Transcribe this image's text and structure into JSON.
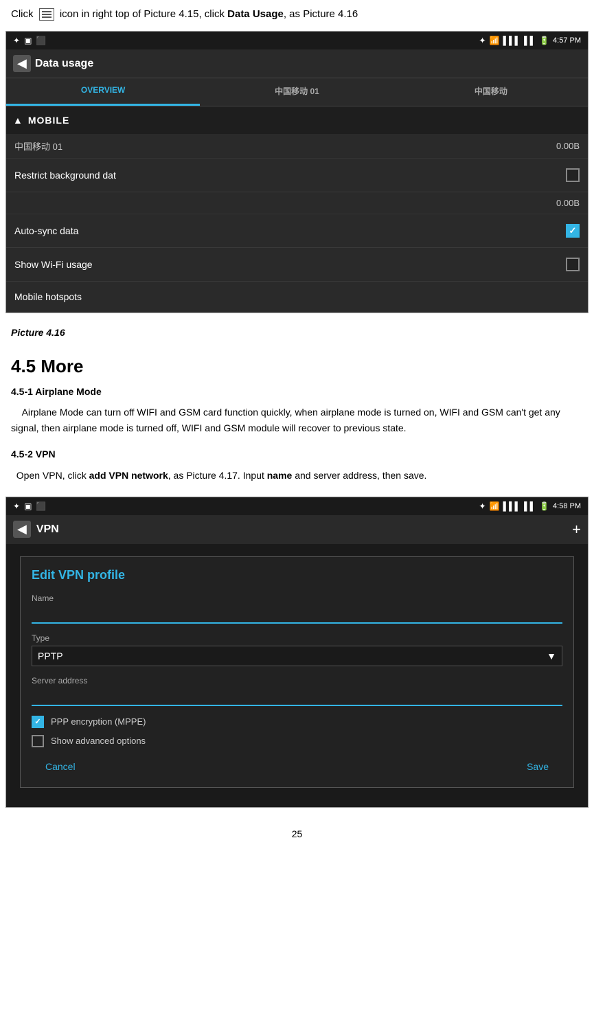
{
  "intro": {
    "text_before": "Click",
    "icon_label": "menu-icon",
    "text_after": " icon in right top of Picture 4.15, click ",
    "bold_text": "Data Usage",
    "text_end": ", as Picture 4.16"
  },
  "data_usage_screen": {
    "status_bar": {
      "time": "4:57 PM",
      "icons": [
        "bluetooth",
        "wifi",
        "signal1",
        "signal2",
        "battery"
      ]
    },
    "title": "Data usage",
    "tabs": [
      {
        "label": "OVERVIEW",
        "active": true
      },
      {
        "label": "中国移动 01",
        "active": false
      },
      {
        "label": "中国移动",
        "active": false
      }
    ],
    "mobile_section": {
      "header": "MOBILE",
      "chevron": "▲",
      "data_row_label": "中国移动 01",
      "data_row_value": "0.00B",
      "menu_items": [
        {
          "label": "Restrict background dat",
          "checked": false
        },
        {
          "label": "Auto-sync data",
          "checked": true
        },
        {
          "label": "Show Wi-Fi usage",
          "checked": false
        },
        {
          "label": "Mobile hotspots",
          "checked": false
        }
      ],
      "second_value": "0.00B"
    }
  },
  "caption": "Picture 4.16",
  "section_title": "4.5 More",
  "subsection_4_5_1": {
    "title": "4.5-1 Airplane Mode",
    "body": "Airplane Mode can turn off WIFI and GSM card function quickly, when airplane mode is turned on, WIFI and GSM can't get any signal, then airplane mode is turned off, WIFI and GSM module will recover to previous state."
  },
  "subsection_4_5_2": {
    "title": "4.5-2 VPN",
    "body_before": "Open VPN, click ",
    "bold_text": "add VPN network",
    "body_after": ", as Picture 4.17. Input ",
    "bold_text2": "name",
    "body_end": " and server address, then save."
  },
  "vpn_screen": {
    "status_bar": {
      "time": "4:58 PM"
    },
    "title": "VPN",
    "dialog_title": "Edit VPN profile",
    "name_label": "Name",
    "name_value": "",
    "type_label": "Type",
    "type_value": "PPTP",
    "server_label": "Server address",
    "server_value": "",
    "ppp_encryption_label": "PPP encryption (MPPE)",
    "ppp_checked": true,
    "advanced_label": "Show advanced options",
    "advanced_checked": false,
    "cancel_label": "Cancel",
    "save_label": "Save"
  },
  "page_number": "25"
}
